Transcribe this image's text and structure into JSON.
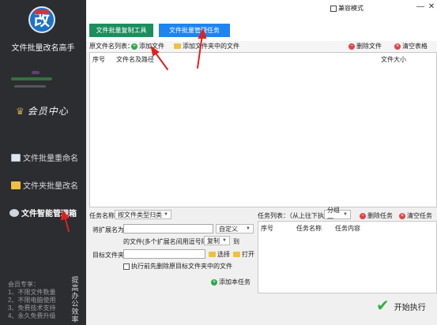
{
  "window": {
    "compat_mode_label": "兼容模式",
    "minimize_glyph": "—",
    "close_glyph": "✕"
  },
  "sidebar": {
    "logo_glyph": "改",
    "app_title": "文件批量改名高手",
    "vip_label": "会员中心",
    "items": [
      {
        "label": "文件批量重命名"
      },
      {
        "label": "文件夹批量改名"
      },
      {
        "label": "文件智能管理箱"
      }
    ],
    "tip_lines": [
      "会员专享：",
      "1、不限文件数量",
      "2、不限电脑使用",
      "3、免费技术支持",
      "4、永久免费升级"
    ],
    "vertical_text": "提高办公效率"
  },
  "tabs": [
    {
      "label": "文件批量复制工具"
    },
    {
      "label": "文件批量管理任务"
    }
  ],
  "file_toolbar": {
    "list_label": "原文件名列表：",
    "add_file": "添加文件",
    "add_folder_files": "添加文件夹中的文件",
    "delete_file": "删除文件",
    "clear_table": "清空表格"
  },
  "file_table": {
    "columns": [
      "序号",
      "文件名及路径",
      "文件大小"
    ]
  },
  "task_form": {
    "task_name_label": "任务名称：",
    "task_name_value": "按文件类型归类",
    "ext_label": "将扩展名为：",
    "ext_value": "",
    "custom_option": "自定义",
    "desc_prefix": "的文件(多个扩展名间用逗号隔开)",
    "copy_mode_value": "复制",
    "to_label": "到",
    "target_label": "目标文件夹：",
    "target_value": "",
    "choose_label": "选择",
    "open_label": "打开",
    "pre_delete_label": "执行前先删除原目标文件夹中的文件",
    "add_task_label": "添加本任务"
  },
  "task_list": {
    "label": "任务列表：（从上往下执行）",
    "group_value": "分组一",
    "delete_task": "删除任务",
    "clear_task": "清空任务",
    "columns": [
      "序号",
      "任务名称",
      "任务内容"
    ]
  },
  "start_label": "开始执行",
  "colors": {
    "sidebar_bg": "#2b2d31",
    "tab_green": "#1c8e5e",
    "tab_blue": "#1e84f0",
    "annotation_red": "#e02020",
    "start_green": "#2fb040"
  }
}
